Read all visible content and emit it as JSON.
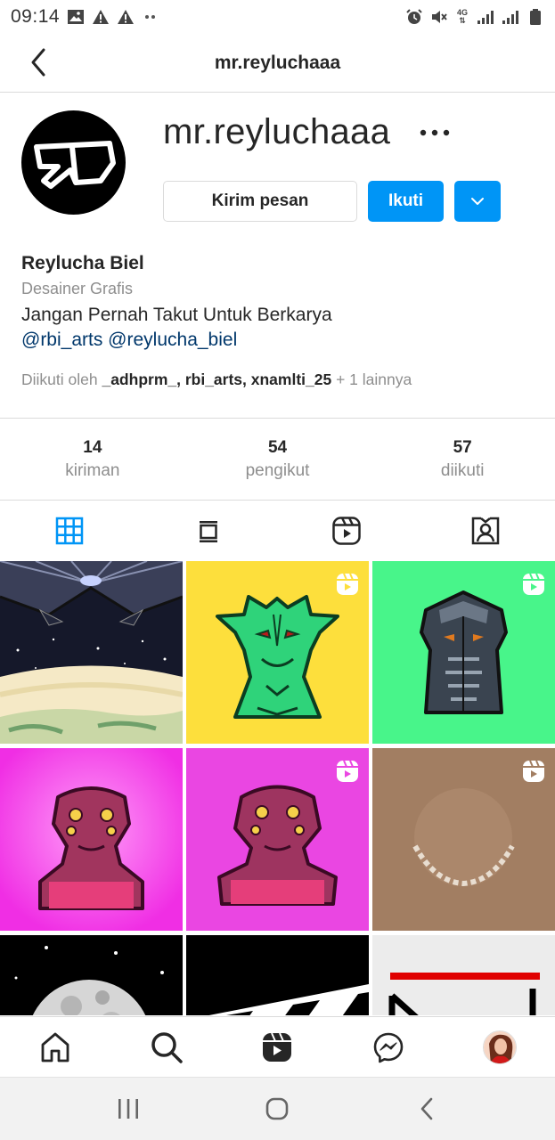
{
  "status_bar": {
    "time": "09:14",
    "left_icons": [
      "image-icon",
      "warning-icon",
      "warning-icon",
      "more-dots-icon"
    ],
    "right_icons": [
      "alarm-icon",
      "mute-icon",
      "4g-icon",
      "signal-icon",
      "signal-icon",
      "battery-icon"
    ],
    "network_label": "4G"
  },
  "header": {
    "title": "mr.reyluchaaa"
  },
  "profile": {
    "username": "mr.reyluchaaa",
    "message_button": "Kirim pesan",
    "follow_button": "Ikuti"
  },
  "bio": {
    "name": "Reylucha Biel",
    "category": "Desainer Grafis",
    "text": "Jangan Pernah Takut Untuk Berkarya",
    "links": "@rbi_arts @reylucha_biel",
    "followed_by": {
      "prefix": "Diikuti oleh ",
      "users": "_adhprm_, rbi_arts, xnamlti_25",
      "suffix": " + 1 lainnya"
    }
  },
  "stats": [
    {
      "value": "14",
      "label": "kiriman"
    },
    {
      "value": "54",
      "label": "pengikut"
    },
    {
      "value": "57",
      "label": "diikuti"
    }
  ],
  "tabs": [
    {
      "icon": "grid-icon",
      "active": true
    },
    {
      "icon": "guide-icon",
      "active": false
    },
    {
      "icon": "reels-icon",
      "active": false
    },
    {
      "icon": "tagged-icon",
      "active": false
    }
  ],
  "posts": [
    {
      "kind": "image",
      "subject": "space-station-earth",
      "bg": "#1a1d2e"
    },
    {
      "kind": "reel",
      "subject": "green-alien",
      "bg": "#fde047"
    },
    {
      "kind": "reel",
      "subject": "armored-alien",
      "bg": "#4ade80"
    },
    {
      "kind": "image",
      "subject": "pink-alien",
      "bg": "#f338e6"
    },
    {
      "kind": "reel",
      "subject": "pink-alien",
      "bg": "#e844e0"
    },
    {
      "kind": "reel",
      "subject": "moon-sketch",
      "bg": "#a27e62"
    },
    {
      "kind": "image",
      "subject": "moon",
      "bg": "#000000"
    },
    {
      "kind": "image",
      "subject": "clapper",
      "bg": "#000000"
    },
    {
      "kind": "image",
      "subject": "logo-sketch",
      "bg": "#ececec"
    }
  ],
  "colors": {
    "accent": "#0095f6",
    "text": "#262626",
    "muted": "#8e8e8e",
    "link": "#00376b",
    "divider": "#dbdbdb"
  },
  "bottom_nav": [
    "home-icon",
    "search-icon",
    "reels-icon",
    "messenger-icon",
    "profile-avatar"
  ],
  "system_nav": [
    "recents-icon",
    "home-circle-icon",
    "back-chevron-icon"
  ]
}
